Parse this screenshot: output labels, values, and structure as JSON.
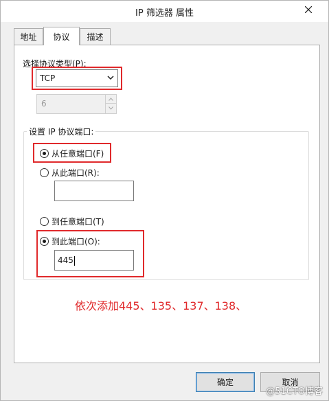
{
  "window": {
    "title": "IP 筛选器 属性"
  },
  "tabs": [
    {
      "label": "地址"
    },
    {
      "label": "协议"
    },
    {
      "label": "描述"
    }
  ],
  "protocol": {
    "type_label": "选择协议类型(P):",
    "selected": "TCP",
    "number_value": "6"
  },
  "ports": {
    "group_label": "设置 IP 协议端口:",
    "from_any": "从任意端口(F)",
    "from_this": "从此端口(R):",
    "from_this_value": "",
    "to_any": "到任意端口(T)",
    "to_this": "到此端口(O):",
    "to_this_value": "445"
  },
  "annotation": "依次添加445、135、137、138、",
  "buttons": {
    "ok": "确定",
    "cancel": "取消"
  },
  "watermark": "@51CTO博客",
  "colors": {
    "highlight": "#e0292b",
    "annotation_text": "#e0292b"
  },
  "icons": {
    "close": "close-icon",
    "dropdown": "chevron-down-icon",
    "spin_up": "chevron-up-icon",
    "spin_down": "chevron-down-icon"
  }
}
